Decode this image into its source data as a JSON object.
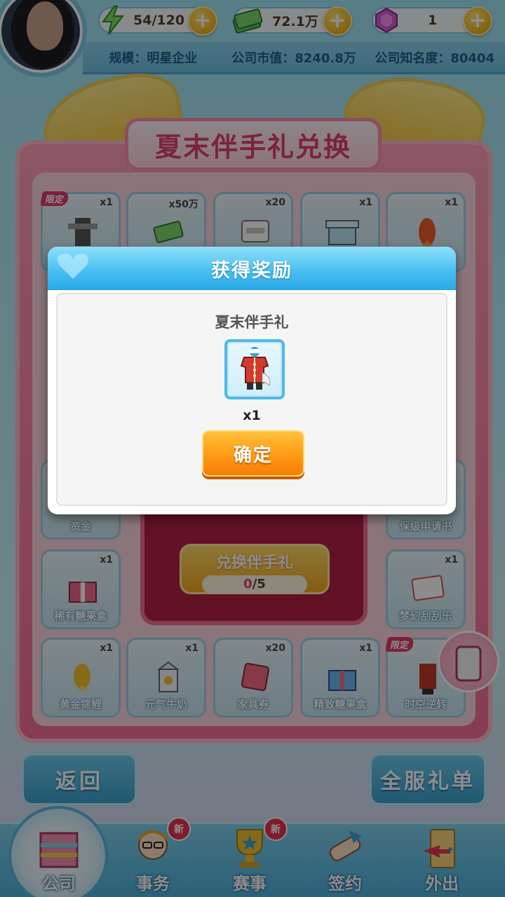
{
  "hud": {
    "energy": "54/120",
    "cash": "72.1万",
    "gems": "1",
    "scale": "规模：明星企业",
    "market_value": "公司市值：8240.8万",
    "fame": "公司知名度：80404",
    "plus_symbol": "+"
  },
  "exchange": {
    "title": "夏末伴手礼兑换",
    "button_label": "兑换伴手礼",
    "progress_current": "0",
    "progress_total": "/5",
    "limited_tag": "限定",
    "items": [
      {
        "name": "",
        "count": "x1",
        "limited": true
      },
      {
        "name": "",
        "count": "x50万",
        "limited": false
      },
      {
        "name": "",
        "count": "x20",
        "limited": false
      },
      {
        "name": "",
        "count": "x1",
        "limited": false
      },
      {
        "name": "",
        "count": "x1",
        "limited": false
      },
      {
        "name": "资金",
        "count": "",
        "limited": false
      },
      {
        "name": "保级申请书",
        "count": "",
        "limited": false
      },
      {
        "name": "稀有糖果盒",
        "count": "x1",
        "limited": false
      },
      {
        "name": "梦幻刮刮乐",
        "count": "x1",
        "limited": false
      },
      {
        "name": "黄金锦鲤",
        "count": "x1",
        "limited": false
      },
      {
        "name": "元气牛奶",
        "count": "x1",
        "limited": false
      },
      {
        "name": "家具券",
        "count": "x20",
        "limited": false
      },
      {
        "name": "精致糖果盒",
        "count": "x1",
        "limited": false
      },
      {
        "name": "时空逆转",
        "count": "x1",
        "limited": true
      }
    ]
  },
  "nav": {
    "back": "返回",
    "server_gifts": "全服礼单"
  },
  "tabs": [
    {
      "label": "公司",
      "new": ""
    },
    {
      "label": "事务",
      "new": "新"
    },
    {
      "label": "赛事",
      "new": "新"
    },
    {
      "label": "签约",
      "new": ""
    },
    {
      "label": "外出",
      "new": ""
    }
  ],
  "modal": {
    "title": "获得奖励",
    "reward_name": "夏末伴手礼",
    "reward_count": "x1",
    "confirm": "确定"
  },
  "colors": {
    "modal_header": "#45bdf0",
    "confirm_button": "#ff9a14",
    "panel_pink": "#f46e94"
  }
}
